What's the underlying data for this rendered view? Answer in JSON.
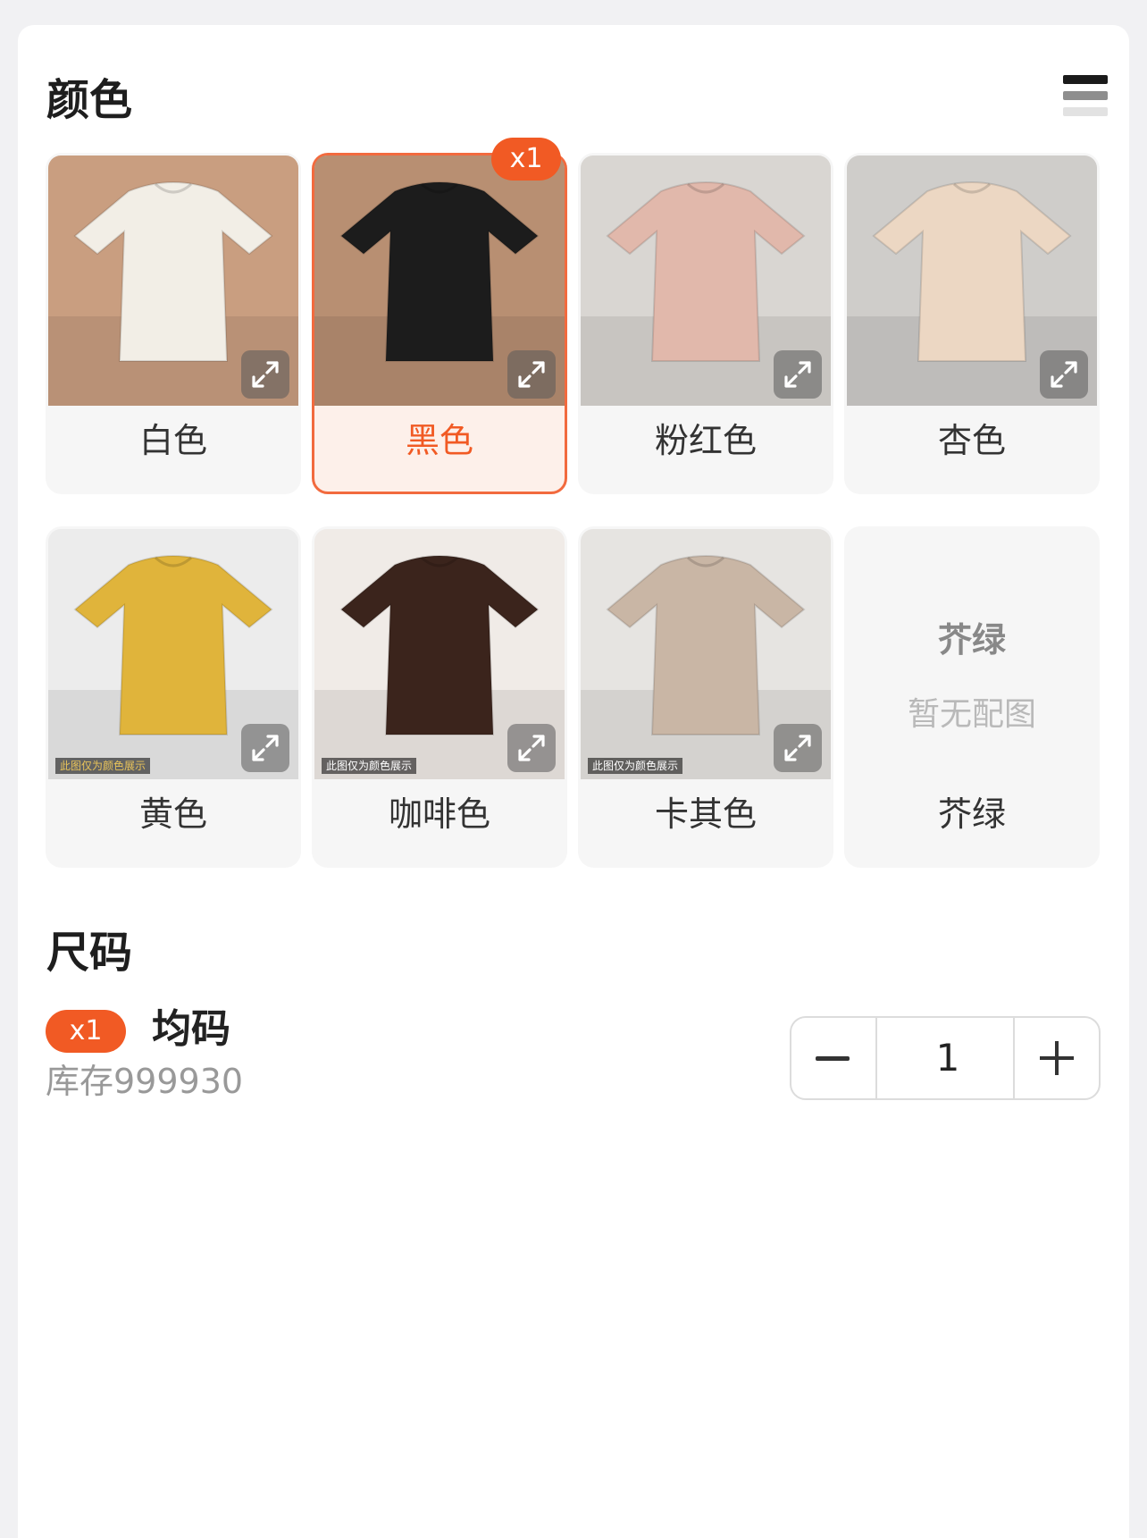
{
  "color_section": {
    "title": "颜色",
    "options": [
      {
        "label": "白色",
        "selected": false,
        "swatch": "#f2eee6",
        "scene": "#c99e80"
      },
      {
        "label": "黑色",
        "selected": true,
        "badge": "x1",
        "swatch": "#1c1c1c",
        "scene": "#b88f72"
      },
      {
        "label": "粉红色",
        "selected": false,
        "swatch": "#e1b8ab",
        "scene": "#d9d6d2"
      },
      {
        "label": "杏色",
        "selected": false,
        "swatch": "#ecd7c3",
        "scene": "#cfcdca"
      },
      {
        "label": "黄色",
        "selected": false,
        "swatch": "#e0b43b",
        "scene": "#ececec",
        "caption": "此图仅为颜色展示",
        "caption_color": "#e8c35a"
      },
      {
        "label": "咖啡色",
        "selected": false,
        "swatch": "#3b241c",
        "scene": "#f0ebe7",
        "caption": "此图仅为颜色展示",
        "caption_color": "#ffffff"
      },
      {
        "label": "卡其色",
        "selected": false,
        "swatch": "#c9b6a5",
        "scene": "#e6e4e1",
        "caption": "此图仅为颜色展示",
        "caption_color": "#ffffff"
      },
      {
        "label": "芥绿",
        "selected": false,
        "no_image": true,
        "placeholder_name": "芥绿",
        "placeholder_note": "暂无配图"
      }
    ]
  },
  "size_section": {
    "title": "尺码",
    "badge": "x1",
    "size_name": "均码",
    "stock": "库存999930",
    "quantity": "1"
  },
  "accent_color": "#f15a24"
}
